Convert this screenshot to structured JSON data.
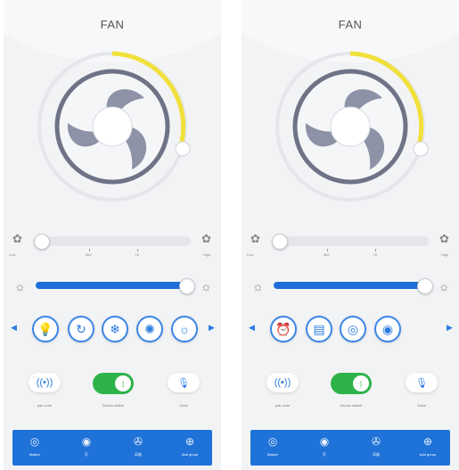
{
  "screens": [
    {
      "title": "FAN",
      "speed_labels": {
        "low": "Low",
        "mid": "Mid",
        "hi": "Hi",
        "high": "High"
      },
      "mode_icons": [
        "bulb-icon",
        "swing-icon",
        "snowflake-icon",
        "fan-mode-icon",
        "sun-icon"
      ],
      "mode_glyphs": [
        "💡",
        "↻",
        "❄",
        "✺",
        "☼"
      ],
      "controls": {
        "pair_label": "pair code",
        "switch_label": "Device switch",
        "voice_label": "Voice"
      },
      "nav": [
        {
          "label": "Master",
          "glyph": "◎"
        },
        {
          "label": "灯",
          "glyph": "◉"
        },
        {
          "label": "风扇",
          "glyph": "✇"
        },
        {
          "label": "Add group",
          "glyph": "⊕"
        }
      ]
    },
    {
      "title": "FAN",
      "speed_labels": {
        "low": "Low",
        "mid": "Mid",
        "hi": "Hi",
        "high": "High"
      },
      "mode_icons": [
        "alarm-clock-icon",
        "timer-icon",
        "cycle-icon",
        "mode-toggle-icon"
      ],
      "mode_glyphs": [
        "⏰",
        "▤",
        "◎",
        "◉"
      ],
      "controls": {
        "pair_label": "pair code",
        "switch_label": "Device switch",
        "voice_label": "Voice"
      },
      "nav": [
        {
          "label": "Master",
          "glyph": "◎"
        },
        {
          "label": "灯",
          "glyph": "◉"
        },
        {
          "label": "风扇",
          "glyph": "✇"
        },
        {
          "label": "Add group",
          "glyph": "⊕"
        }
      ]
    }
  ],
  "colors": {
    "accent": "#1e72d8",
    "arc": "#f1e03a",
    "toggle": "#2db34a"
  },
  "fan_speed_level": 0.05,
  "brightness_level": 0.98,
  "power_on": true
}
